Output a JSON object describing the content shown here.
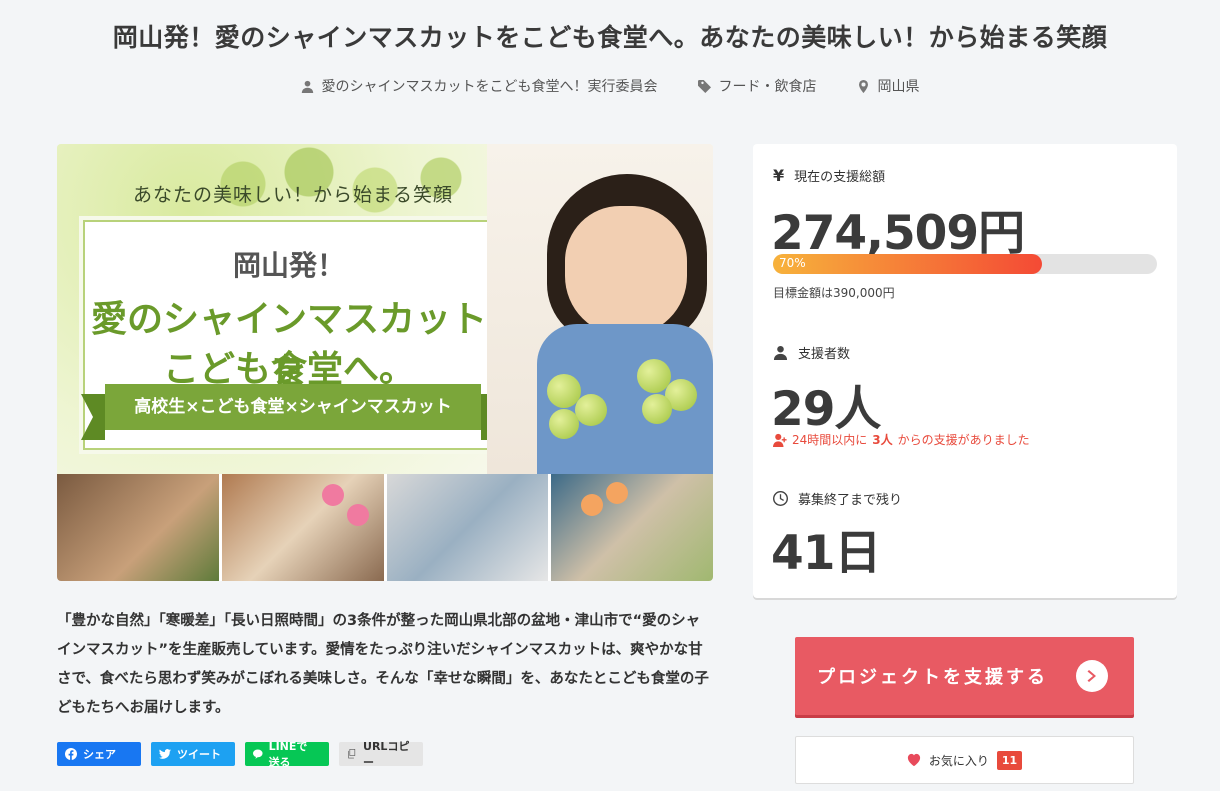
{
  "project": {
    "title": "岡山発！愛のシャインマスカットをこども食堂へ。あなたの美味しい！から始まる笑顔",
    "owner": "愛のシャインマスカットをこども食堂へ！実行委員会",
    "category": "フード・飲食店",
    "location": "岡山県"
  },
  "hero": {
    "tagline": "あなたの美味しい！から始まる笑顔",
    "title_line1": "岡山発！",
    "title_line2": "愛のシャインマスカットを",
    "title_line3": "こども食堂へ。",
    "ribbon": "高校生×こども食堂×シャインマスカット"
  },
  "description": "「豊かな自然」「寒暖差」「長い日照時間」の3条件が整った岡山県北部の盆地・津山市で“愛のシャインマスカット”を生産販売しています。愛情をたっぷり注いだシャインマスカットは、爽やかな甘さで、食べたら思わず笑みがこぼれる美味しさ。そんな「幸せな瞬間」を、あなたとこども食堂の子どもたちへお届けします。",
  "share": {
    "facebook": "シェア",
    "twitter": "ツイート",
    "line": "LINEで送る",
    "copy": "URLコピー"
  },
  "stats": {
    "amount_label": "現在の支援総額",
    "amount": "274,509円",
    "progress_text": "70%",
    "progress": 0.7,
    "goal": "目標金額は390,000円",
    "supporters_label": "支援者数",
    "supporters": "29人",
    "recent_prefix": "24時間以内に",
    "recent_count": "3人",
    "recent_suffix": "からの支援がありました",
    "remaining_label": "募集終了まで残り",
    "remaining": "41日"
  },
  "cta": {
    "label": "プロジェクトを支援する"
  },
  "favorite": {
    "label": "お気に入り",
    "count": "11"
  },
  "colors": {
    "accent": "#e85a63",
    "progress_start": "#f7b23b",
    "progress_end": "#f44a35",
    "facebook": "#1877f2",
    "twitter": "#1da1f2",
    "line": "#06c755"
  }
}
